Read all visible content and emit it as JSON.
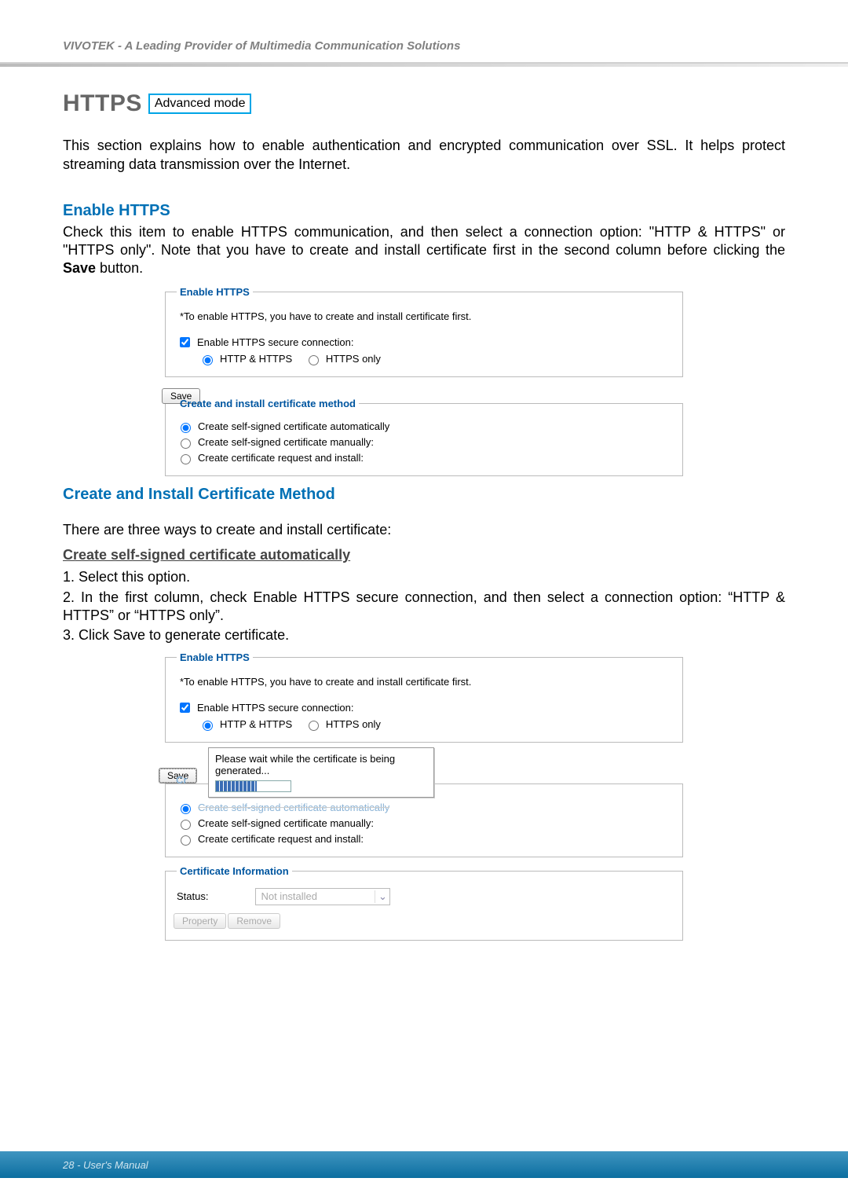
{
  "header": {
    "brand": "VIVOTEK - A Leading Provider of Multimedia Communication Solutions"
  },
  "title": {
    "main": "HTTPS",
    "badge": "Advanced mode"
  },
  "intro": "This section explains how to enable authentication and encrypted communication over SSL. It helps protect streaming data transmission over the Internet.",
  "enable": {
    "heading": "Enable HTTPS",
    "text_pre": "Check this item to enable HTTPS communication, and then select a connection option: \"HTTP & HTTPS\" or \"HTTPS only\". Note that you have to create and install certificate first in the second column before clicking the ",
    "text_bold": "Save",
    "text_post": " button."
  },
  "ui1": {
    "legend_enable": "Enable HTTPS",
    "note": "*To enable HTTPS, you have to create and install certificate first.",
    "chk_label": "Enable HTTPS secure connection:",
    "opt1": "HTTP & HTTPS",
    "opt2": "HTTPS only",
    "save": "Save",
    "legend_method": "Create and install certificate method",
    "m1": "Create self-signed certificate automatically",
    "m2": "Create self-signed certificate manually:",
    "m3": "Create certificate request and install:"
  },
  "cert_method": {
    "heading": "Create and Install Certificate Method",
    "intro": "There are three ways to create and install certificate:",
    "sub": "Create self-signed certificate automatically",
    "step1": "1. Select this option.",
    "step2_pre": "2. In the first column, check ",
    "step2_b": "Enable HTTPS secure connection",
    "step2_post": ", and then select a connection option: “HTTP & HTTPS” or “HTTPS only”.",
    "step3_pre": "3. Click ",
    "step3_b": "Save",
    "step3_post": " to generate certificate."
  },
  "ui2": {
    "popup": "Please wait while the certificate is being generated...",
    "legend_certinfo": "Certificate Information",
    "status_label": "Status:",
    "status_value": "Not installed",
    "btn_property": "Property",
    "btn_remove": "Remove",
    "behind_label": "Cr"
  },
  "footer": "28 - User's Manual"
}
